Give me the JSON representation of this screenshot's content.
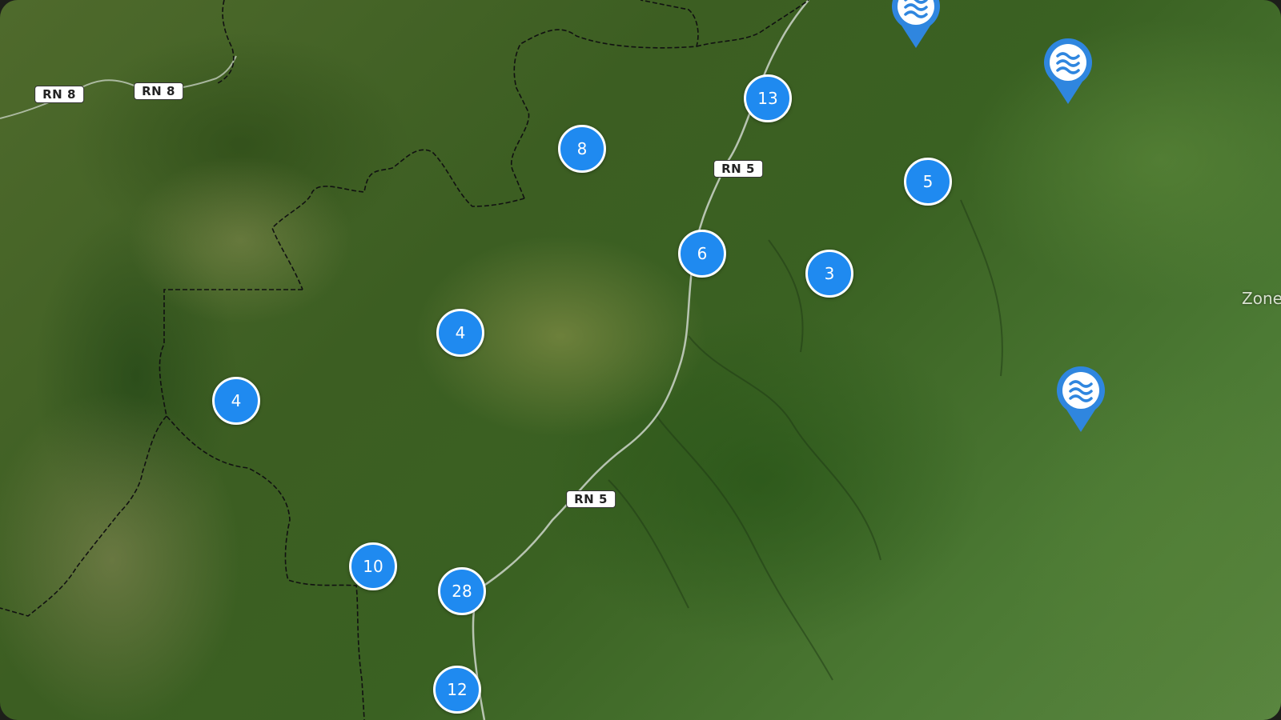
{
  "map": {
    "road_labels": {
      "rn8_a": "RN 8",
      "rn8_b": "RN 8",
      "rn5_a": "RN 5",
      "rn5_b": "RN 5"
    },
    "clusters": {
      "c13": "13",
      "c8": "8",
      "c5": "5",
      "c6": "6",
      "c3": "3",
      "c4_center": "4",
      "c4_west": "4",
      "c10": "10",
      "c28": "28",
      "c12": "12"
    },
    "place_label": "Zone",
    "marker_icon": "water-waves-icon",
    "colors": {
      "cluster": "#1f8af0",
      "pin": "#2f86df"
    }
  }
}
